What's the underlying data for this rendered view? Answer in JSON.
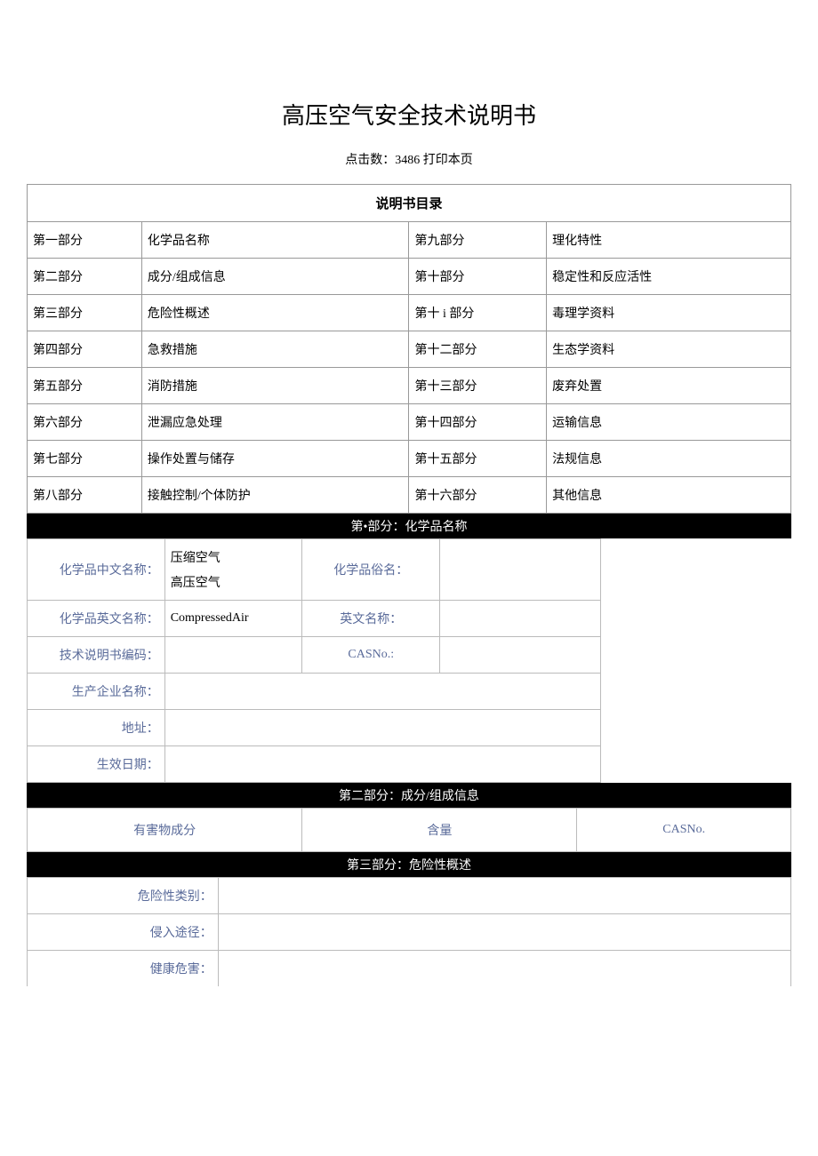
{
  "title": "高压空气安全技术说明书",
  "subtitle_prefix": "点击数：",
  "click_count": "3486",
  "print_label": "打印本页",
  "toc": {
    "header": "说明书目录",
    "rows": [
      {
        "left_part": "第一部分",
        "left_name": "化学品名称",
        "right_part": "第九部分",
        "right_name": "理化特性"
      },
      {
        "left_part": "第二部分",
        "left_name": "成分/组成信息",
        "right_part": "第十部分",
        "right_name": "稳定性和反应活性"
      },
      {
        "left_part": "第三部分",
        "left_name": "危险性概述",
        "right_part": "第十 i 部分",
        "right_name": "毒理学资料"
      },
      {
        "left_part": "第四部分",
        "left_name": "急救措施",
        "right_part": "第十二部分",
        "right_name": "生态学资料"
      },
      {
        "left_part": "第五部分",
        "left_name": "消防措施",
        "right_part": "第十三部分",
        "right_name": "废弃处置"
      },
      {
        "left_part": "第六部分",
        "left_name": "泄漏应急处理",
        "right_part": "第十四部分",
        "right_name": "运输信息"
      },
      {
        "left_part": "第七部分",
        "left_name": "操作处置与储存",
        "right_part": "第十五部分",
        "right_name": "法规信息"
      },
      {
        "left_part": "第八部分",
        "left_name": "接触控制/个体防护",
        "right_part": "第十六部分",
        "right_name": "其他信息"
      }
    ]
  },
  "section1": {
    "header": "第•部分：化学品名称",
    "rows": {
      "cn_name_label": "化学品中文名称：",
      "cn_name_value1": "压缩空气",
      "cn_name_value2": "高压空气",
      "common_name_label": "化学品俗名：",
      "common_name_value": "",
      "en_name_label": "化学品英文名称：",
      "en_name_value": "CompressedAir",
      "en_alt_label": "英文名称：",
      "en_alt_value": "",
      "code_label": "技术说明书编码：",
      "code_value": "",
      "cas_label": "CASNo.:",
      "cas_value": "",
      "producer_label": "生产企业名称：",
      "producer_value": "",
      "address_label": "地址：",
      "address_value": "",
      "effective_label": "生效日期：",
      "effective_value": ""
    }
  },
  "section2": {
    "header": "第二部分：成分/组成信息",
    "cols": {
      "component": "有害物成分",
      "content": "含量",
      "casno": "CASNo."
    }
  },
  "section3": {
    "header": "第三部分：危险性概述",
    "rows": {
      "category_label": "危险性类别：",
      "category_value": "",
      "route_label": "侵入途径：",
      "route_value": "",
      "health_label": "健康危害：",
      "health_value": ""
    }
  }
}
